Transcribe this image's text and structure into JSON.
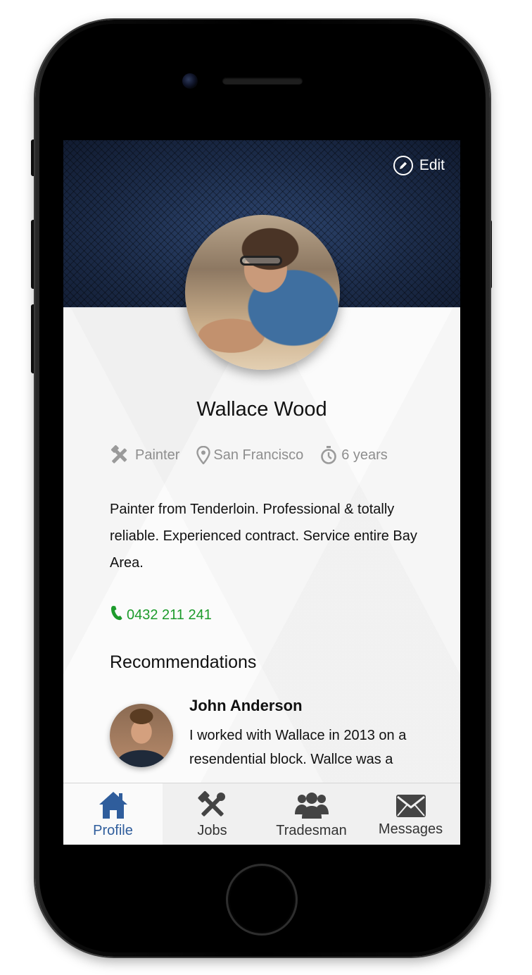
{
  "profile": {
    "edit_label": "Edit",
    "name": "Wallace Wood",
    "trade": "Painter",
    "location": "San Francisco",
    "experience": "6 years",
    "bio": "Painter from Tenderloin. Professional & totally reliable. Experienced contract. Service entire Bay Area.",
    "phone": "0432 211 241"
  },
  "recommendations": {
    "title": "Recommendations",
    "items": [
      {
        "name": "John Anderson",
        "text": "I worked with Wallace in 2013 on a resendential block. Wallce was a"
      }
    ]
  },
  "tabbar": {
    "tabs": [
      {
        "label": "Profile",
        "icon": "home-icon",
        "active": true
      },
      {
        "label": "Jobs",
        "icon": "tools-icon",
        "active": false
      },
      {
        "label": "Tradesman",
        "icon": "group-icon",
        "active": false
      },
      {
        "label": "Messages",
        "icon": "envelope-icon",
        "active": false
      }
    ]
  },
  "colors": {
    "accent": "#2f5d9c",
    "phone_green": "#1d9b2c",
    "hero_navy": "#1d2d4b",
    "meta_gray": "#8e8e8e"
  }
}
